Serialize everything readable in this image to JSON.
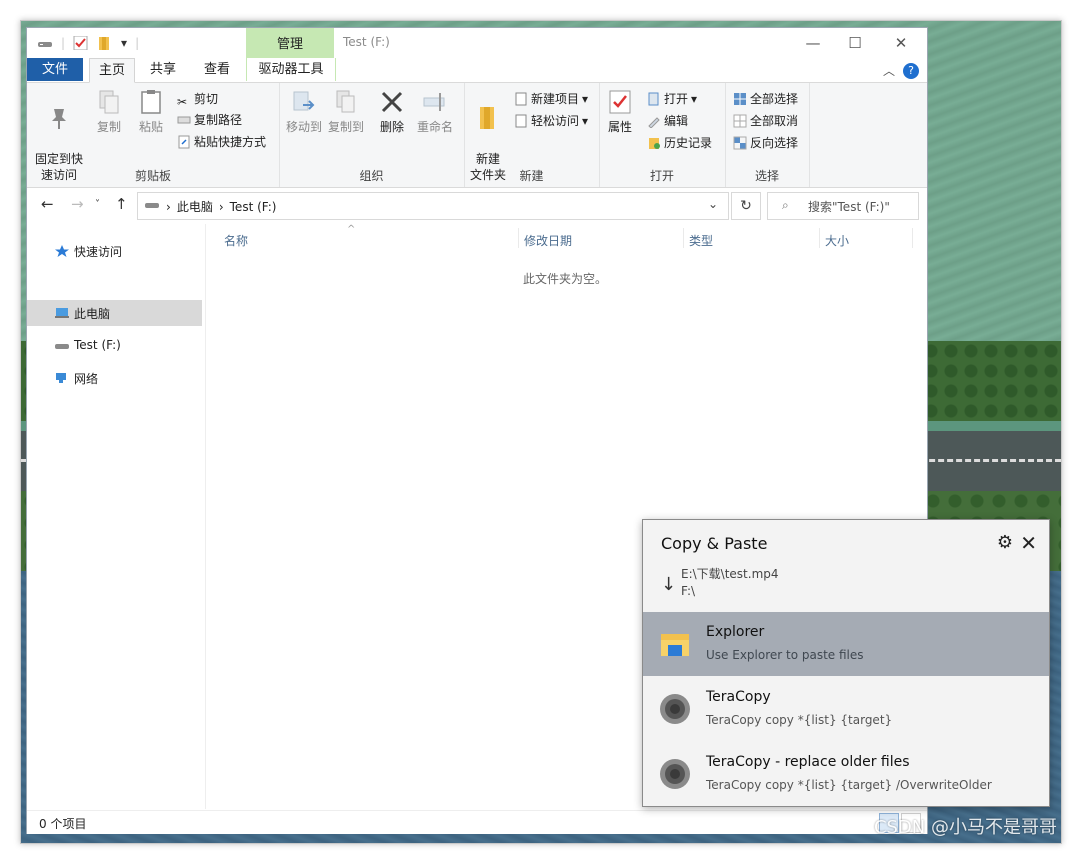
{
  "window": {
    "title": "Test (F:)",
    "manage_tab": "管理",
    "controls": {
      "minimize": "—",
      "maximize": "☐",
      "close": "✕"
    }
  },
  "ribbon_tabs": [
    "文件",
    "主页",
    "共享",
    "查看",
    "驱动器工具"
  ],
  "ribbon": {
    "clipboard": {
      "label": "剪贴板",
      "pin": "固定到快\n速访问",
      "copy": "复制",
      "paste": "粘贴",
      "cut": "剪切",
      "copy_path": "复制路径",
      "paste_shortcut": "粘贴快捷方式"
    },
    "organize": {
      "label": "组织",
      "move_to": "移动到",
      "copy_to": "复制到",
      "delete": "删除",
      "rename": "重命名"
    },
    "new": {
      "label": "新建",
      "new_folder": "新建\n文件夹",
      "new_item": "新建项目",
      "easy_access": "轻松访问"
    },
    "open": {
      "label": "打开",
      "properties": "属性",
      "open": "打开",
      "edit": "编辑",
      "history": "历史记录"
    },
    "select": {
      "label": "选择",
      "select_all": "全部选择",
      "select_none": "全部取消",
      "invert": "反向选择"
    }
  },
  "address": {
    "crumbs": [
      "此电脑",
      "Test (F:)"
    ],
    "search_placeholder": "搜索\"Test (F:)\""
  },
  "nav_pane": [
    {
      "label": "快速访问",
      "icon": "star-icon"
    },
    {
      "label": "此电脑",
      "icon": "computer-icon",
      "selected": true
    },
    {
      "label": "Test (F:)",
      "icon": "drive-icon"
    },
    {
      "label": "网络",
      "icon": "network-icon"
    }
  ],
  "columns": [
    "名称",
    "修改日期",
    "类型",
    "大小"
  ],
  "empty_message": "此文件夹为空。",
  "status": {
    "items": "0 个项目"
  },
  "popup": {
    "title": "Copy & Paste",
    "source": "E:\\下载\\test.mp4",
    "destination": "F:\\",
    "options": [
      {
        "name": "Explorer",
        "desc": "Use Explorer to paste files",
        "selected": true
      },
      {
        "name": "TeraCopy",
        "desc": "TeraCopy copy *{list} {target}"
      },
      {
        "name": "TeraCopy - replace older files",
        "desc": "TeraCopy copy *{list} {target} /OverwriteOlder"
      }
    ]
  },
  "watermark": "CSDN @小马不是哥哥",
  "colors": {
    "file_tab": "#1f5fa8",
    "manage_tab": "#c6e8b3",
    "popup_selected": "#a5abb4",
    "accent": "#1f6fcf"
  }
}
